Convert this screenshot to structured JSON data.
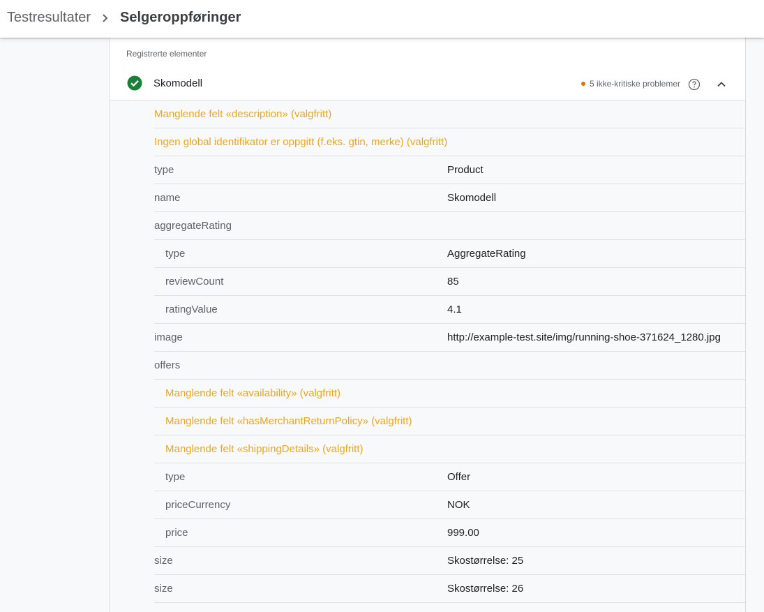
{
  "breadcrumb": {
    "root": "Testresultater",
    "current": "Selgeroppføringer"
  },
  "panel": {
    "title": "Registrerte elementer",
    "item": {
      "name": "Skomodell",
      "issues": "5 ikke-kritiske problemer"
    },
    "rows": [
      {
        "kind": "warn",
        "indent": 0,
        "text": "Manglende felt «description» (valgfritt)"
      },
      {
        "kind": "warn",
        "indent": 0,
        "text": "Ingen global identifikator er oppgitt (f.eks. gtin, merke) (valgfritt)"
      },
      {
        "kind": "kv",
        "indent": 0,
        "key": "type",
        "value": "Product"
      },
      {
        "kind": "kv",
        "indent": 0,
        "key": "name",
        "value": "Skomodell"
      },
      {
        "kind": "kv",
        "indent": 0,
        "key": "aggregateRating",
        "value": ""
      },
      {
        "kind": "kv",
        "indent": 1,
        "key": "type",
        "value": "AggregateRating"
      },
      {
        "kind": "kv",
        "indent": 1,
        "key": "reviewCount",
        "value": "85"
      },
      {
        "kind": "kv",
        "indent": 1,
        "key": "ratingValue",
        "value": "4.1"
      },
      {
        "kind": "kv",
        "indent": 0,
        "key": "image",
        "value": "http://example-test.site/img/running-shoe-371624_1280.jpg"
      },
      {
        "kind": "kv",
        "indent": 0,
        "key": "offers",
        "value": ""
      },
      {
        "kind": "warn",
        "indent": 1,
        "text": "Manglende felt «availability» (valgfritt)"
      },
      {
        "kind": "warn",
        "indent": 1,
        "text": "Manglende felt «hasMerchantReturnPolicy» (valgfritt)"
      },
      {
        "kind": "warn",
        "indent": 1,
        "text": "Manglende felt «shippingDetails» (valgfritt)"
      },
      {
        "kind": "kv",
        "indent": 1,
        "key": "type",
        "value": "Offer"
      },
      {
        "kind": "kv",
        "indent": 1,
        "key": "priceCurrency",
        "value": "NOK"
      },
      {
        "kind": "kv",
        "indent": 1,
        "key": "price",
        "value": "999.00"
      },
      {
        "kind": "kv",
        "indent": 0,
        "key": "size",
        "value": "Skostørrelse: 25"
      },
      {
        "kind": "kv",
        "indent": 0,
        "key": "size",
        "value": "Skostørrelse: 26"
      }
    ]
  },
  "colors": {
    "warning": "#f2a51a",
    "success": "#188038",
    "issue_dot": "#e37400"
  }
}
